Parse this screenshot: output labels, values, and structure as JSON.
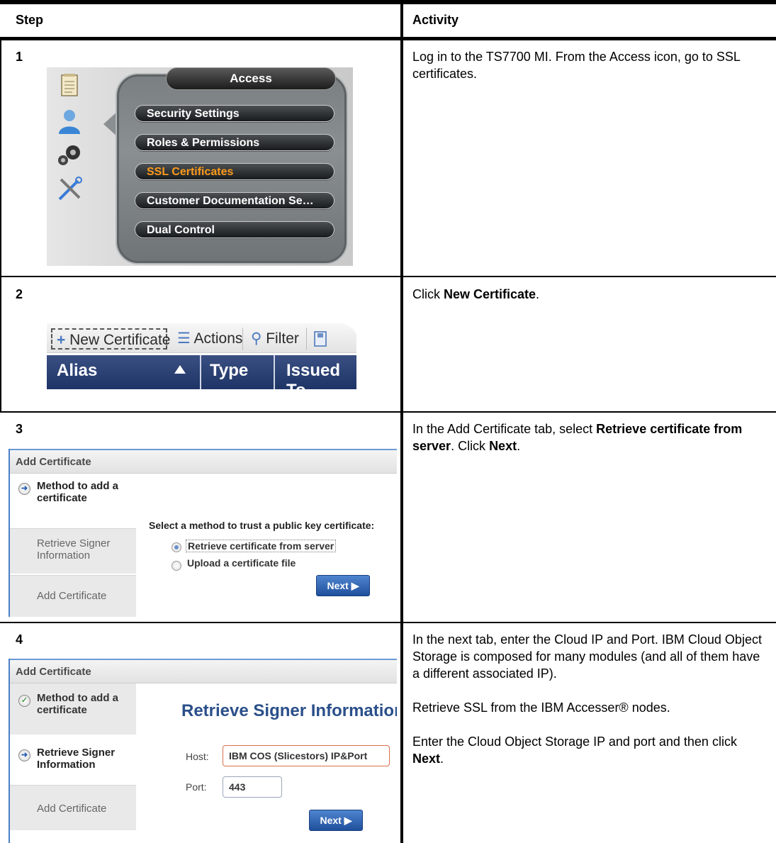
{
  "table": {
    "col_step": "Step",
    "col_activity": "Activity"
  },
  "rows": [
    {
      "step": "1",
      "activity": [
        "Log in to the TS7700 MI. From the Access icon, go to SSL certificates."
      ],
      "access_menu": {
        "title": "Access",
        "items": [
          "Security Settings",
          "Roles & Permissions",
          "SSL Certificates",
          "Customer Documentation Se…",
          "Dual Control"
        ],
        "active_index": 2,
        "active_color": "#ff9a1a"
      }
    },
    {
      "step": "2",
      "activity_pre": "Click ",
      "activity_bold": "New Certificate",
      "activity_post": ".",
      "toolbar": {
        "new_certificate": "New Certificate",
        "actions": "Actions",
        "filter": "Filter",
        "columns": [
          "Alias",
          "Type",
          "Issued To"
        ]
      }
    },
    {
      "step": "3",
      "activity_pre": "In the Add Certificate tab, select ",
      "activity_bold": "Retrieve certificate from server",
      "activity_mid": ". Click ",
      "activity_bold2": "Next",
      "activity_post": ".",
      "dialog": {
        "title": "Add Certificate",
        "wizard": [
          "Method to add a certificate",
          "Retrieve Signer Information",
          "Add Certificate"
        ],
        "prompt": "Select a method to trust a public key certificate:",
        "option_retrieve": "Retrieve certificate from server",
        "option_upload": "Upload a certificate file",
        "next": "Next ▶"
      }
    },
    {
      "step": "4",
      "activity_p1": "In the next tab, enter the Cloud IP and Port. IBM Cloud Object Storage is composed for many modules (and all of them have a different associated IP).",
      "activity_p2": "Retrieve SSL from the IBM Accesser® nodes.",
      "activity_p3_pre": "Enter the Cloud Object Storage IP and port and then click ",
      "activity_p3_bold": "Next",
      "activity_p3_post": ".",
      "dialog": {
        "title": "Add Certificate",
        "wizard": [
          "Method to add a certificate",
          "Retrieve Signer Information",
          "Add Certificate"
        ],
        "heading": "Retrieve Signer Information",
        "host_label": "Host:",
        "host_value": "IBM COS (Slicestors) IP&Port",
        "port_label": "Port:",
        "port_value": "443",
        "next": "Next ▶"
      }
    }
  ]
}
